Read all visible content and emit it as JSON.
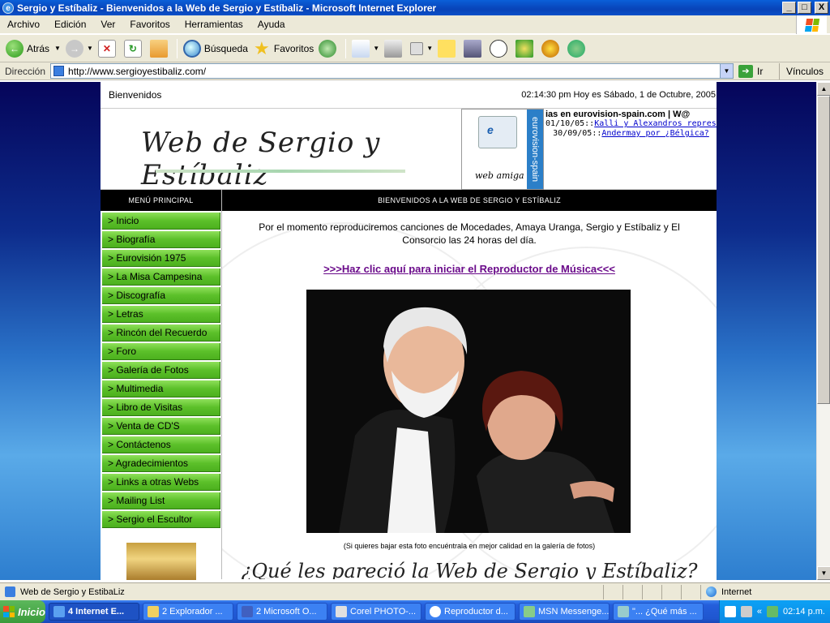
{
  "window": {
    "title": "Sergio y Estíbaliz - Bienvenidos a la Web de Sergio y Estíbaliz - Microsoft Internet Explorer",
    "min": "_",
    "max": "□",
    "close": "X"
  },
  "menubar": [
    "Archivo",
    "Edición",
    "Ver",
    "Favoritos",
    "Herramientas",
    "Ayuda"
  ],
  "toolbar": {
    "back": "Atrás",
    "search": "Búsqueda",
    "favorites": "Favoritos"
  },
  "address": {
    "label": "Dirección",
    "url": "http://www.sergioyestibaliz.com/",
    "go": "Ir",
    "links": "Vínculos"
  },
  "page": {
    "welcome": "Bienvenidos",
    "datetime": "02:14:30 pm Hoy es Sábado, 1 de Octubre, 2005",
    "site_name": "Web de Sergio y Estíbaliz",
    "banner": {
      "tagline": "web amiga",
      "vertical": "eurovision-spain"
    },
    "ticker": {
      "heading": "ias en eurovision-spain.com | W@",
      "items": [
        {
          "date": "01/10/05::",
          "text": "Kalli y Alexandros representarán a Grecia en Hasselt"
        },
        {
          "date": "30/09/05::",
          "text": "Andermay por ¿Bélgica?"
        }
      ]
    },
    "menu_title": "MENÚ PRINCIPAL",
    "menu": [
      "> Inicio",
      "> Biografía",
      "> Eurovisión 1975",
      "> La Misa Campesina",
      "> Discografía",
      "> Letras",
      "> Rincón del Recuerdo",
      "> Foro",
      "> Galería de Fotos",
      "> Multimedia",
      "> Libro de Visitas",
      "> Venta de CD'S",
      "> Contáctenos",
      "> Agradecimientos",
      "> Links a otras Webs",
      "> Mailing List",
      "> Sergio el Escultor"
    ],
    "main_title": "BIENVENIDOS A LA WEB DE SERGIO Y ESTÍBALIZ",
    "intro": "Por el momento reproduciremos canciones de Mocedades, Amaya Uranga, Sergio y Estíbaliz y El Consorcio las 24 horas del día.",
    "cta": ">>>Haz clic aquí para iniciar el Reproductor de Música<<<",
    "caption": "(Si quieres bajar esta foto encuéntrala en mejor calidad en la galería de fotos)",
    "question": "¿Qué les pareció la Web de Sergio y Estíbaliz?"
  },
  "statusbar": {
    "text": "Web de Sergio y EstibaLiz",
    "zone": "Internet"
  },
  "taskbar": {
    "start": "Inicio",
    "tasks": [
      "4 Internet E...",
      "2 Explorador ...",
      "2 Microsoft O...",
      "Corel PHOTO-...",
      "Reproductor d...",
      "MSN Messenge...",
      "\"... ¿Qué más ..."
    ],
    "clock": "02:14 p.m."
  },
  "colors": {
    "menu_green": "#5cc02a",
    "cta_purple": "#6a0a8a",
    "title_blue": "#0843b8"
  }
}
